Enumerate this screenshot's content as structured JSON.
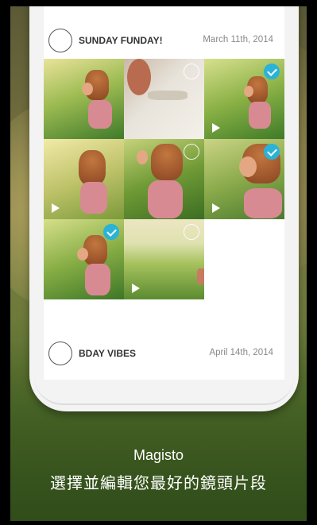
{
  "moments": [
    {
      "title": "SUNDAY FUNDAY!",
      "date": "March 11th, 2014",
      "tiles": [
        {
          "video": false,
          "selected": false
        },
        {
          "video": false,
          "selected": false
        },
        {
          "video": true,
          "selected": true
        },
        {
          "video": true,
          "selected": false
        },
        {
          "video": false,
          "selected": false
        },
        {
          "video": true,
          "selected": true
        },
        {
          "video": false,
          "selected": true
        },
        {
          "video": true,
          "selected": false
        }
      ]
    },
    {
      "title": "BDAY VIBES",
      "date": "April 14th, 2014"
    }
  ],
  "caption": {
    "app_name": "Magisto",
    "subtitle": "選擇並編輯您最好的鏡頭片段"
  },
  "colors": {
    "accent": "#2ab3d6"
  }
}
